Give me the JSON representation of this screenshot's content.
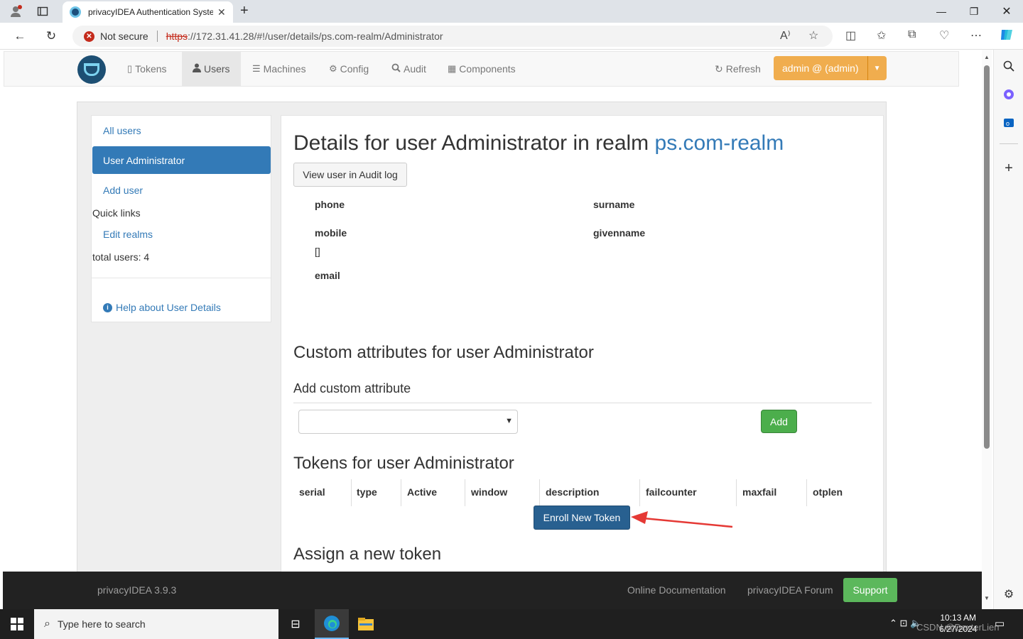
{
  "browser": {
    "tab_title": "privacyIDEA Authentication Syste",
    "security_label": "Not secure",
    "url_scheme": "https",
    "url_rest": "://172.31.41.28/#!/user/details/ps.com-realm/Administrator"
  },
  "nav": {
    "items": [
      {
        "icon": "tablet-icon",
        "label": "Tokens"
      },
      {
        "icon": "user-icon",
        "label": "Users"
      },
      {
        "icon": "list-icon",
        "label": "Machines"
      },
      {
        "icon": "gear-icon",
        "label": "Config"
      },
      {
        "icon": "search-icon",
        "label": "Audit"
      },
      {
        "icon": "calendar-icon",
        "label": "Components"
      }
    ],
    "active": "Users",
    "refresh_label": "Refresh",
    "admin_label": "admin @ (admin)"
  },
  "sidebar": {
    "all_users": "All users",
    "active_user": "User Administrator",
    "add_user": "Add user",
    "quick_links": "Quick links",
    "edit_realms": "Edit realms",
    "total_users": "total users: 4",
    "help": "Help about User Details"
  },
  "details": {
    "title_prefix": "Details for user Administrator in realm",
    "realm": "ps.com-realm",
    "audit_button": "View user in Audit log",
    "fields": {
      "phone": "phone",
      "surname": "surname",
      "mobile": "mobile",
      "mobile_value": "[]",
      "givenname": "givenname",
      "email": "email"
    }
  },
  "custom": {
    "title": "Custom attributes for user Administrator",
    "add_title": "Add custom attribute",
    "add_button": "Add"
  },
  "tokens": {
    "title": "Tokens for user Administrator",
    "columns": [
      "serial",
      "type",
      "Active",
      "window",
      "description",
      "failcounter",
      "maxfail",
      "otplen"
    ],
    "enroll_button": "Enroll New Token"
  },
  "assign": {
    "title": "Assign a new token"
  },
  "footer": {
    "version": "privacyIDEA 3.9.3",
    "docs": "Online Documentation",
    "forum": "privacyIDEA Forum",
    "support": "Support"
  },
  "taskbar": {
    "search_placeholder": "Type here to search",
    "time": "10:13 AM",
    "date": "6/27/2024",
    "watermark": "CSDN @DexterLien"
  },
  "colors": {
    "primary": "#337ab7",
    "warning": "#f0ad4e",
    "success": "#5cb85c",
    "footer": "#222222"
  }
}
